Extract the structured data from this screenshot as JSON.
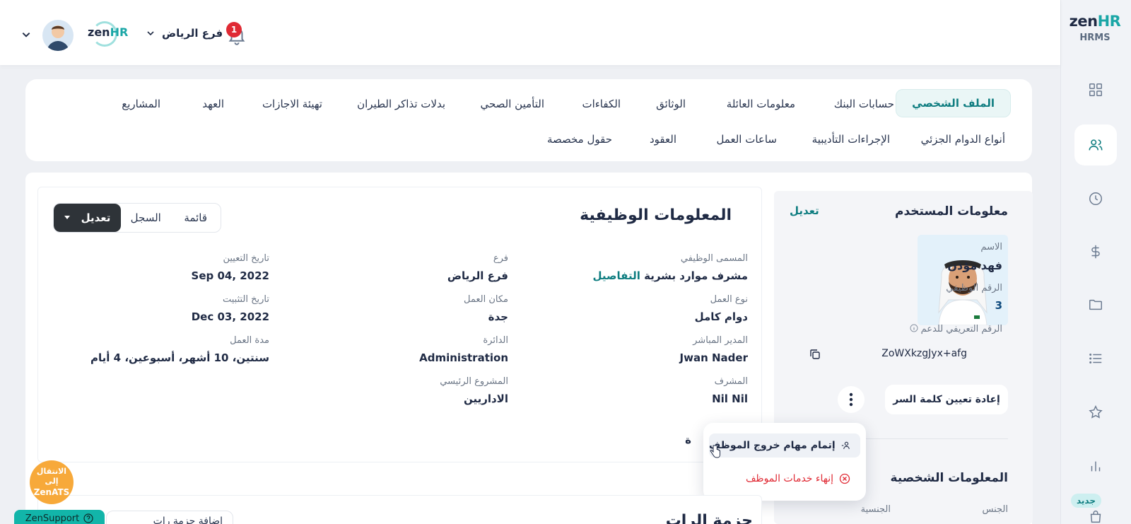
{
  "brand": {
    "logo_main": "zen",
    "logo_hr": "HR",
    "logo_sub": "HRMS",
    "accent": "#0e7d80"
  },
  "sidebar": {
    "icons": [
      "grid-icon",
      "users-icon",
      "clock-icon",
      "dollar-icon",
      "folder-icon",
      "list-icon",
      "star-icon",
      "chart-icon",
      "bag-icon"
    ],
    "new_badge": "جديد"
  },
  "topbar": {
    "notification_count": "1",
    "branch": "فرع الرياض",
    "mini_logo_main": "zen",
    "mini_logo_hr": "HR"
  },
  "tabs": {
    "row1": [
      "الملف الشخصي",
      "حسابات البنك",
      "معلومات العائلة",
      "الوثائق",
      "الكفاءات",
      "التأمين الصحي",
      "بدلات تذاكر الطيران",
      "تهيئة الاجازات",
      "العهد",
      "المشاريع"
    ],
    "row2": [
      "أنواع الدوام الجزئي",
      "الإجراءات التأديبية",
      "ساعات العمل",
      "العقود",
      "حقول مخصصة"
    ]
  },
  "job_info": {
    "title": "المعلومات الوظيفية",
    "buttons": {
      "edit": "تعديل",
      "history": "السجل",
      "list": "قائمة"
    },
    "fields": {
      "job_title_label": "المسمى الوظيفي",
      "job_title_value": "مشرف موارد بشرية",
      "job_title_link": "التفاصيل",
      "work_type_label": "نوع العمل",
      "work_type_value": "دوام كامل",
      "manager_label": "المدير المباشر",
      "manager_value": "Jwan Nader",
      "supervisor_label": "المشرف",
      "supervisor_value": "Nil Nil",
      "branch_label": "فرع",
      "branch_value": "فرع الرياض",
      "workplace_label": "مكان العمل",
      "workplace_value": "جدة",
      "department_label": "الدائرة",
      "department_value": "Administration",
      "main_project_label": "المشروع الرئيسي",
      "main_project_value": "الاداريين",
      "hire_date_label": "تاريخ التعيين",
      "hire_date_value": "Sep 04, 2022",
      "confirm_date_label": "تاريخ التثبيت",
      "confirm_date_value": "Dec 03, 2022",
      "service_label": "مدة العمل",
      "service_value": "سنتين، 10 أشهر، أسبوعين، 4 أيام",
      "partial_label": "ة"
    }
  },
  "dropdown": {
    "complete_exit": "إتمام مهام خروج الموظف",
    "terminate": "إنهاء خدمات الموظف"
  },
  "user_info": {
    "title": "معلومات المستخدم",
    "edit": "تعديل",
    "name_label": "الاسم",
    "name_value": "فهد مؤذن",
    "emp_no_label": "الرقم الوظيفي",
    "emp_no_value": "3",
    "support_id_label": "الرقم التعريفي للدعم",
    "support_id_value": "ZoWXkzgJyx+afg",
    "reset_password": "إعادة تعيين كلمة السر"
  },
  "personal_info": {
    "title": "المعلومات الشخصية",
    "gender_label": "الجنس",
    "nationality_label": "الجنسية"
  },
  "floating": {
    "ats_line1": "الانتقال إلى",
    "ats_line2": "ZenATS",
    "support": "ZenSupport"
  },
  "bottom": {
    "title": "حزمة الرات",
    "add_button": "إضافة حزمة رات"
  }
}
